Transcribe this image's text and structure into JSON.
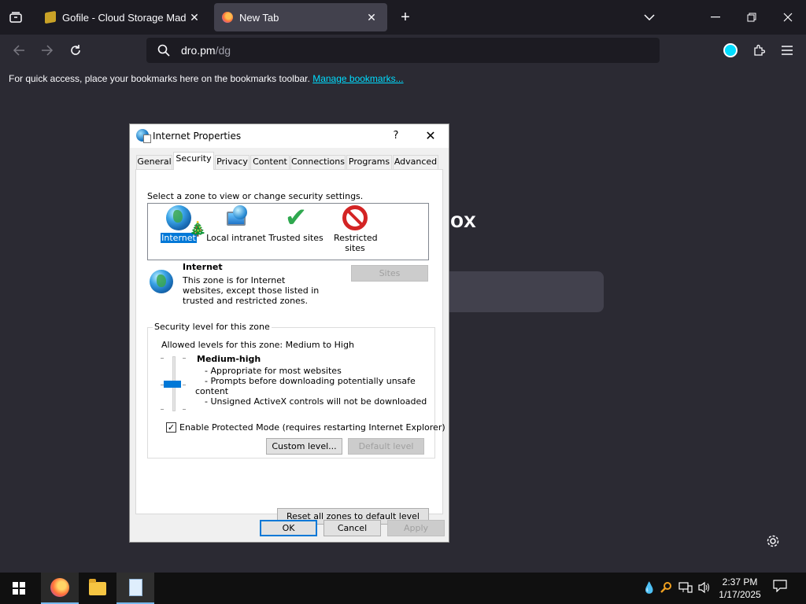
{
  "browser": {
    "tabs": [
      {
        "label": "Gofile - Cloud Storage Made Simple",
        "active": false
      },
      {
        "label": "New Tab",
        "active": true
      }
    ],
    "new_tab_symbol": "+",
    "url_host": "dro.pm",
    "url_path": "/dg",
    "bookmarks_bar_text": "For quick access, place your bookmarks here on the bookmarks toolbar.",
    "manage_bookmarks_link": "Manage bookmarks...",
    "page_hero_fragment": "ox",
    "accent_color": "#00ddff"
  },
  "dialog": {
    "title": "Internet Properties",
    "help": "?",
    "close": "✕",
    "tabs": [
      "General",
      "Security",
      "Privacy",
      "Content",
      "Connections",
      "Programs",
      "Advanced"
    ],
    "active_tab": "Security",
    "zone_prompt": "Select a zone to view or change security settings.",
    "zones": [
      {
        "label": "Internet",
        "selected": true
      },
      {
        "label": "Local intranet",
        "selected": false
      },
      {
        "label": "Trusted sites",
        "selected": false
      },
      {
        "label": "Restricted sites",
        "selected": false
      }
    ],
    "zone_info": {
      "title": "Internet",
      "description": "This zone is for Internet websites, except those listed in trusted and restricted zones."
    },
    "sites_button": "Sites",
    "security_group_label": "Security level for this zone",
    "allowed_levels": "Allowed levels for this zone: Medium to High",
    "level_name": "Medium-high",
    "level_bullets": [
      "- Appropriate for most websites",
      "- Prompts before downloading potentially unsafe",
      "content",
      "- Unsigned ActiveX controls will not be downloaded"
    ],
    "protected_mode_label": "Enable Protected Mode (requires restarting Internet Explorer)",
    "protected_mode_checked": true,
    "custom_level_button": "Custom level...",
    "default_level_button": "Default level",
    "reset_zones_button": "Reset all zones to default level",
    "ok_button": "OK",
    "cancel_button": "Cancel",
    "apply_button": "Apply"
  },
  "taskbar": {
    "time": "2:37 PM",
    "date": "1/17/2025"
  }
}
